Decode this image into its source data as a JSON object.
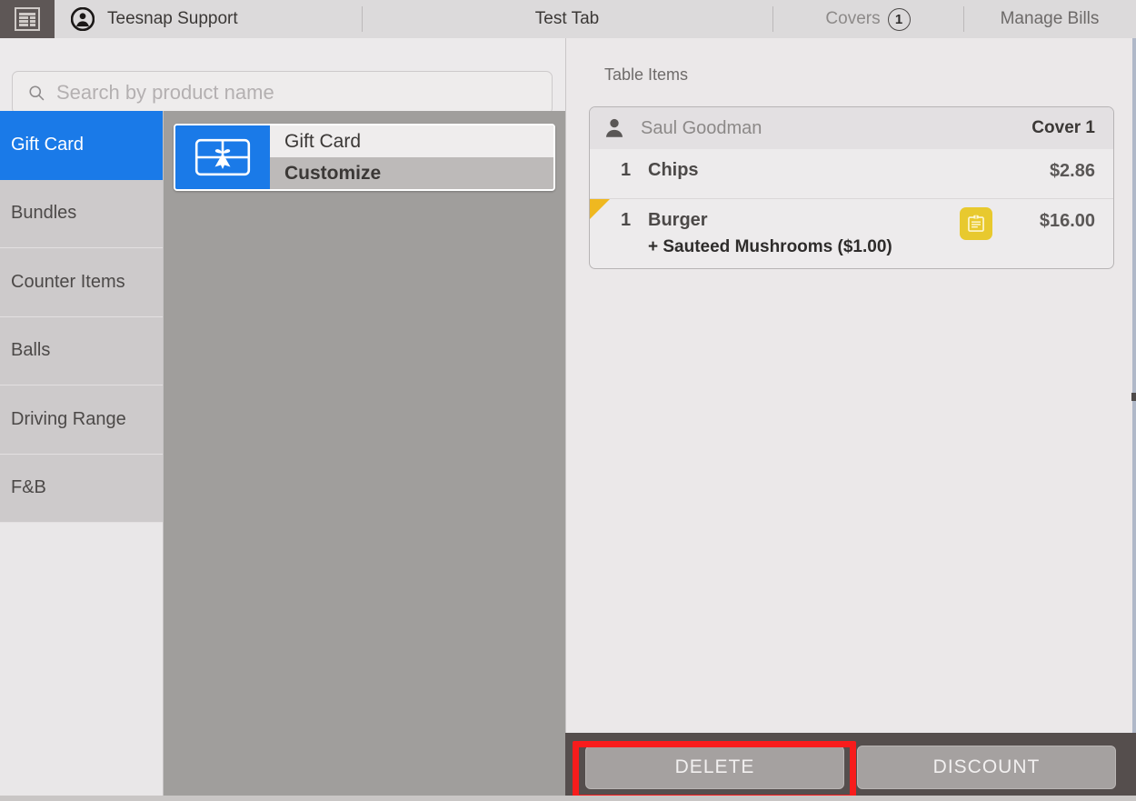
{
  "header": {
    "menu_icon": "hamburger-menu-icon",
    "user_icon": "user-avatar-icon",
    "user_name": "Teesnap Support",
    "tab_test": "Test Tab",
    "tab_covers_label": "Covers",
    "tab_covers_count": "1",
    "tab_manage_bills": "Manage Bills"
  },
  "search": {
    "icon": "search-icon",
    "placeholder": "Search by product name",
    "value": ""
  },
  "sidebar": {
    "items": [
      {
        "label": "Gift Card",
        "selected": true
      },
      {
        "label": "Bundles",
        "selected": false
      },
      {
        "label": "Counter Items",
        "selected": false
      },
      {
        "label": "Balls",
        "selected": false
      },
      {
        "label": "Driving Range",
        "selected": false
      },
      {
        "label": "F&B",
        "selected": false
      }
    ]
  },
  "products": {
    "tiles": [
      {
        "icon": "gift-card-icon",
        "name": "Gift Card",
        "action": "Customize"
      }
    ]
  },
  "table_items": {
    "title": "Table Items",
    "cover": {
      "icon": "person-icon",
      "name": "Saul Goodman",
      "label": "Cover 1"
    },
    "items": [
      {
        "qty": "1",
        "name": "Chips",
        "modifier": "",
        "price": "$2.86",
        "note_icon": "",
        "flagged": false
      },
      {
        "qty": "1",
        "name": "Burger",
        "modifier": "+ Sauteed Mushrooms  ($1.00)",
        "price": "$16.00",
        "note_icon": "note-clipboard-icon",
        "flagged": true
      }
    ]
  },
  "footer": {
    "delete_label": "DELETE",
    "discount_label": "DISCOUNT"
  },
  "colors": {
    "accent_blue": "#1a7ae8",
    "note_yellow": "#e8c92e",
    "flag_amber": "#efb820",
    "highlight_red": "#f81c1c",
    "footer_dark": "#554e4d",
    "grid_gray": "#a09e9c",
    "panel_light": "#ebe8e9"
  }
}
